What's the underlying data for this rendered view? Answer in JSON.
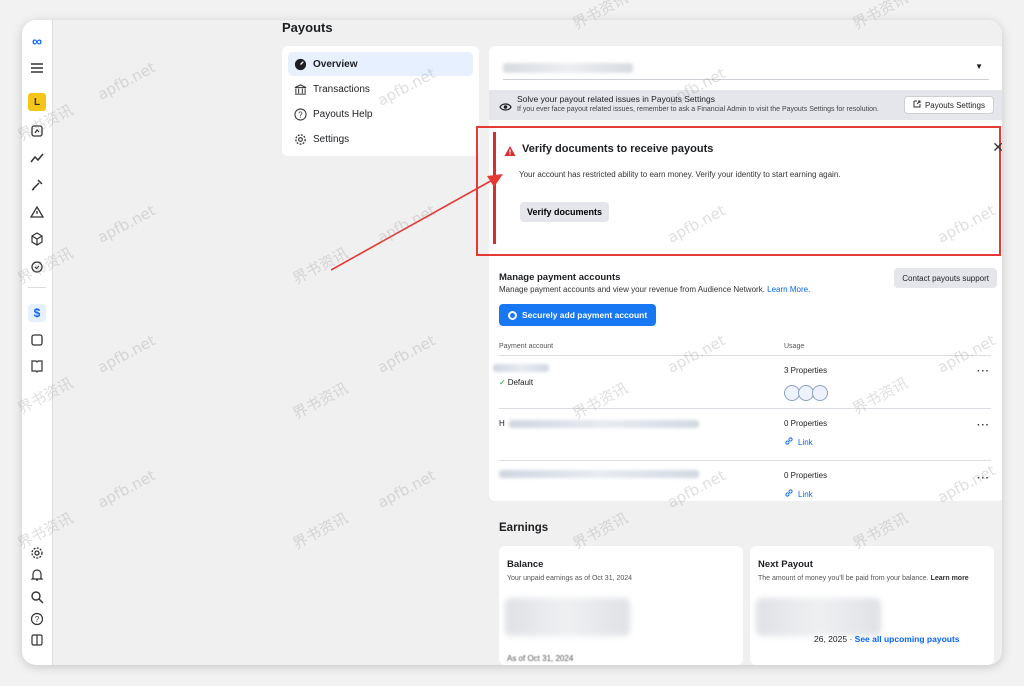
{
  "page": {
    "title": "Payouts"
  },
  "nav": {
    "items": [
      {
        "label": "Overview",
        "icon": "dashboard-icon",
        "active": true
      },
      {
        "label": "Transactions",
        "icon": "bank-icon",
        "active": false
      },
      {
        "label": "Payouts Help",
        "icon": "question-icon",
        "active": false
      },
      {
        "label": "Settings",
        "icon": "gear-icon",
        "active": false
      }
    ]
  },
  "rail": {
    "avatar_letter": "L",
    "dollar": "$"
  },
  "info_bar": {
    "line1": "Solve your payout related issues in Payouts Settings",
    "line2": "If you ever face payout related issues, remember to ask a Financial Admin to visit the Payouts Settings for resolution.",
    "button": "Payouts Settings"
  },
  "alert": {
    "title": "Verify documents to receive payouts",
    "body": "Your account has restricted ability to earn money. Verify your identity to start earning again.",
    "button": "Verify documents",
    "close": "✕",
    "color": "#d32f2f"
  },
  "accounts": {
    "title": "Manage payment accounts",
    "subtitle": "Manage payment accounts and view your revenue from Audience Network.",
    "learn_more": "Learn More.",
    "contact": "Contact payouts support",
    "add_button": "Securely add payment account",
    "col_account": "Payment account",
    "col_usage": "Usage",
    "rows": [
      {
        "account_prefix": "",
        "default": "Default",
        "usage": "3 Properties",
        "link": ""
      },
      {
        "account_prefix": "H",
        "default": "",
        "usage": "0 Properties",
        "link": "Link"
      },
      {
        "account_prefix": "",
        "default": "",
        "usage": "0 Properties",
        "link": "Link"
      }
    ]
  },
  "earnings": {
    "title": "Earnings",
    "balance": {
      "title": "Balance",
      "subtitle": "Your unpaid earnings as of Oct 31, 2024",
      "foot": "As of Oct 31, 2024"
    },
    "next": {
      "title": "Next Payout",
      "subtitle": "The amount of money you'll be paid from your balance.",
      "learn_more": "Learn more",
      "date": "26, 2025 ·",
      "see_all": "See all upcoming payouts"
    }
  },
  "watermark": {
    "latin": "apfb.net",
    "cjk": "界书资讯"
  },
  "colors": {
    "accent": "#1877f2",
    "link": "#0866ff",
    "alert_outline": "#e53935"
  }
}
